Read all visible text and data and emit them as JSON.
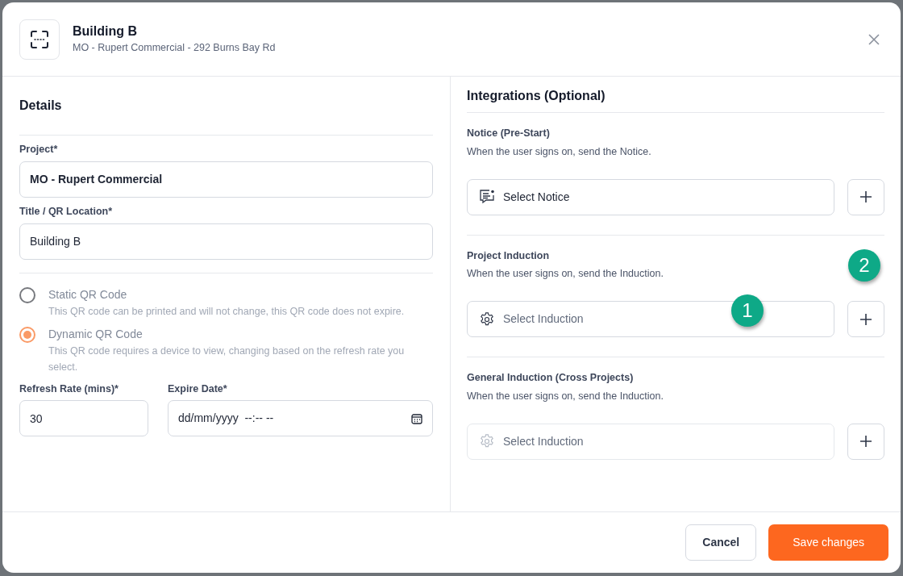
{
  "header": {
    "title": "Building B",
    "subtitle": "MO - Rupert Commercial - 292 Burns Bay Rd"
  },
  "details": {
    "heading": "Details",
    "fields": [
      {
        "label": "Project*",
        "value": "MO - Rupert Commercial",
        "bold": true
      },
      {
        "label": "Title / QR Location*",
        "value": "Building B",
        "bold": false
      }
    ],
    "qr_options": [
      {
        "label": "Static QR Code",
        "description": "This QR code can be printed and will not change, this QR code does not expire.",
        "selected": false,
        "disabled": true
      },
      {
        "label": "Dynamic QR Code",
        "description": "This QR code requires a device to view, changing based on the refresh rate you select.",
        "selected": true,
        "disabled": true
      }
    ],
    "refresh_rate": {
      "label": "Refresh Rate (mins)*",
      "value": "30"
    },
    "expire_date": {
      "label": "Expire Date*",
      "value": "dd/mm/yyyy  --:-- --"
    }
  },
  "integrations": {
    "heading": "Integrations (Optional)",
    "sections": [
      {
        "title": "Notice (Pre-Start)",
        "description": "When the user signs on, send the Notice.",
        "select": "Select Notice",
        "kind": "notice",
        "chosen": true,
        "disabled": false
      },
      {
        "title": "Project Induction",
        "description": "When the user signs on, send the Induction.",
        "select": "Select Induction",
        "kind": "induction",
        "chosen": false,
        "disabled": false
      },
      {
        "title": "General Induction (Cross Projects)",
        "description": "When the user signs on, send the Induction.",
        "select": "Select Induction",
        "kind": "induction",
        "chosen": false,
        "disabled": true
      }
    ]
  },
  "callouts": [
    {
      "text": "1"
    },
    {
      "text": "2"
    }
  ],
  "footer": {
    "buttons": [
      {
        "label": "Cancel",
        "kind": "secondary"
      },
      {
        "label": "Save changes",
        "kind": "primary"
      }
    ]
  }
}
